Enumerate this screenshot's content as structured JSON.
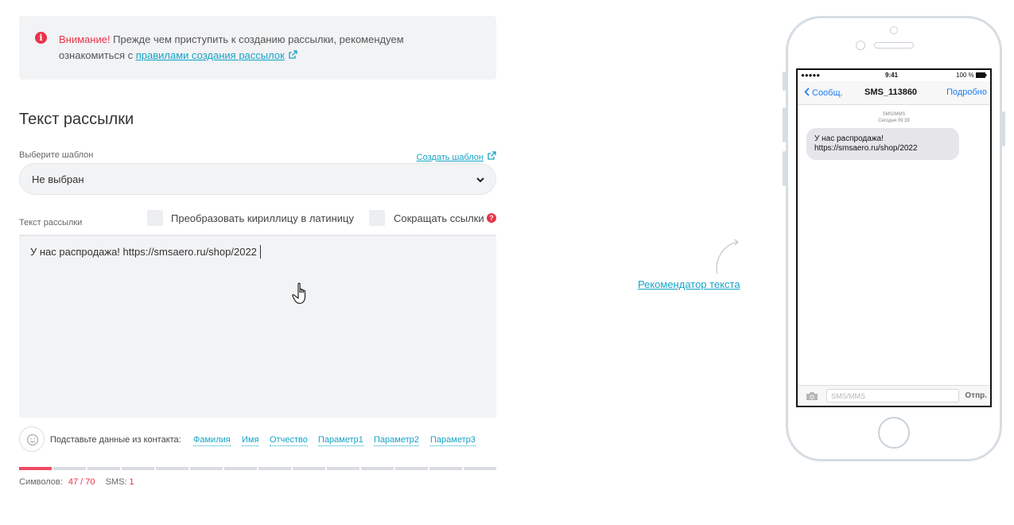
{
  "alert": {
    "warning_word": "Внимание!",
    "text_before_link": " Прежде чем приступить к созданию рассылки, рекомендуем ознакомиться с ",
    "link_text": "правилами создания рассылок"
  },
  "section_title": "Текст рассылки",
  "template": {
    "label": "Выберите шаблон",
    "create_link": "Создать шаблон",
    "selected_value": "Не выбран"
  },
  "message": {
    "label": "Текст рассылки",
    "transliterate_label": "Преобразовать кириллицу в латиницу",
    "transliterate_checked": false,
    "shorten_links_label": "Сокращать ссылки",
    "shorten_links_checked": false,
    "help_glyph": "?",
    "text": "У нас распродажа! https://smsaero.ru/shop/2022"
  },
  "contact_vars": {
    "label": "Подставьте данные из контакта:",
    "items": [
      "Фамилия",
      "Имя",
      "Отчество",
      "Параметр1",
      "Параметр2",
      "Параметр3"
    ]
  },
  "progress": {
    "segments": 14,
    "filled": 1
  },
  "counter": {
    "chars_label": "Символов:",
    "chars_value": "47 / 70",
    "sms_label": "SMS:",
    "sms_value": "1"
  },
  "recommender_link": "Рекомендатор текста",
  "phone_preview": {
    "status_left": "●●●●● ",
    "status_time": "9:41",
    "status_battery": "100 %",
    "back_label": "Сообщ.",
    "sender": "SMS_113860",
    "details_label": "Подробно",
    "msg_type": "SMS/MMS",
    "msg_time": "Сегодня 09:39",
    "bubble_text": "У нас распродажа! https://smsaero.ru/shop/2022",
    "input_placeholder": "SMS/MMS",
    "send_label": "Отпр."
  },
  "colors": {
    "accent_red": "#e8334a",
    "link_teal": "#14a3c7",
    "ios_blue": "#1a7cf4",
    "panel_gray": "#f2f3f5"
  }
}
